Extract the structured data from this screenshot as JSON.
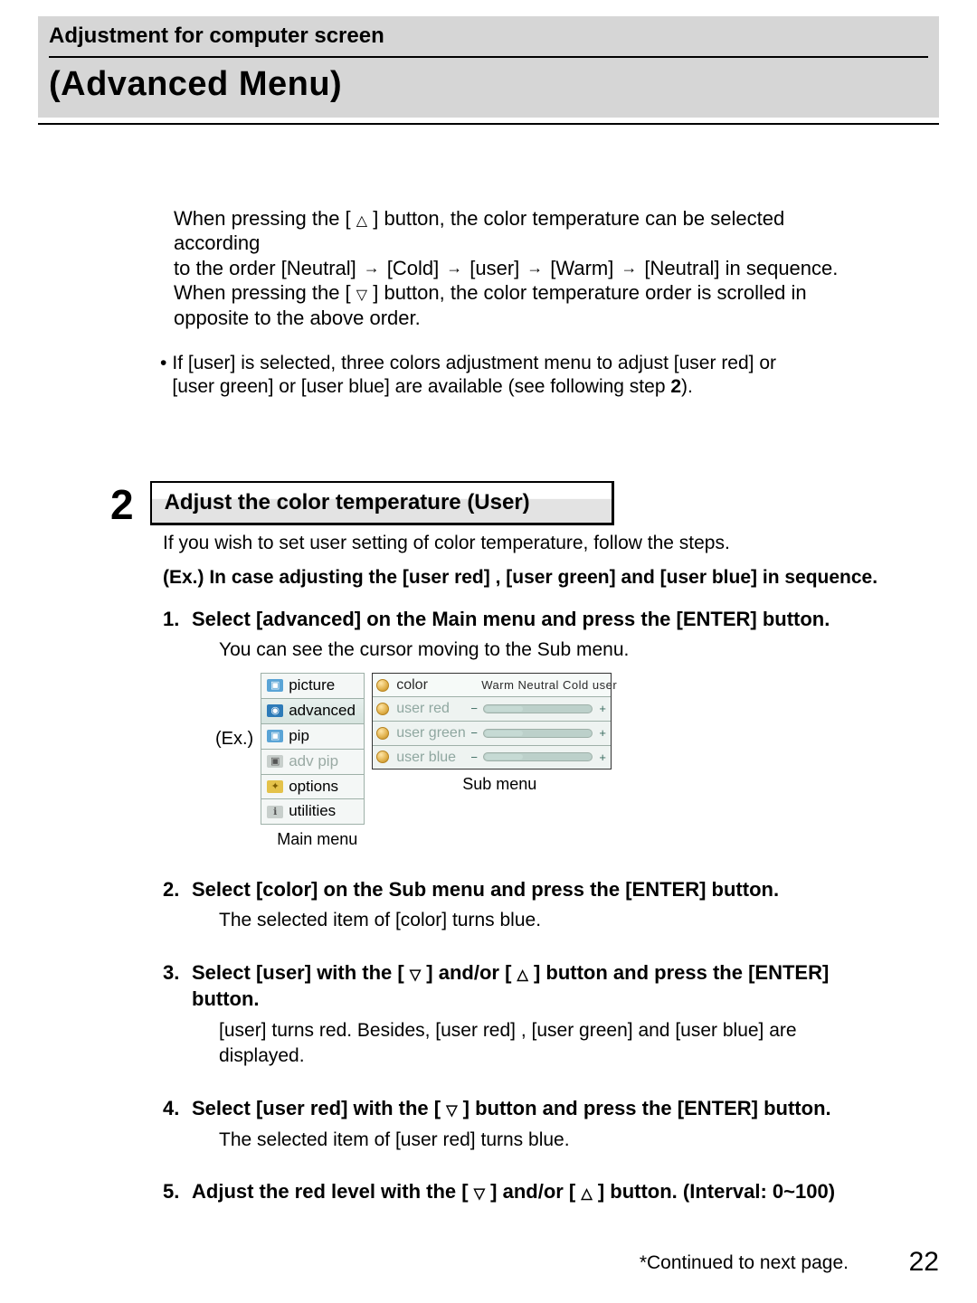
{
  "header": {
    "section_title": "Adjustment for computer screen",
    "page_title": "(Advanced Menu)"
  },
  "intro": {
    "line1_a": "When pressing the [",
    "line1_b": "] button, the color temperature can be selected according",
    "line2_a": "to the order [Neutral]",
    "line2_b": "[Cold]",
    "line2_c": "[user]",
    "line2_d": "[Warm]",
    "line2_e": "[Neutral] in sequence.",
    "line3_a": "When pressing the [",
    "line3_b": "] button, the color temperature order is scrolled in",
    "line4": "opposite to the above order."
  },
  "bullet": {
    "a": "If [user] is selected, three colors adjustment menu to adjust [user red] or",
    "b_1": "[user green] or [user blue] are available (see following step ",
    "b_num": "2",
    "b_2": ")."
  },
  "step2": {
    "num": "2",
    "head": "Adjust the color temperature (User)",
    "intro": "If you wish to set user setting of color temperature, follow the steps.",
    "ex_a": "(Ex.) In case adjusting the ",
    "ex_b": "[user red]",
    "ex_c": ", ",
    "ex_d": "[user green]",
    "ex_e": " and ",
    "ex_f": "[user blue]",
    "ex_g": " in sequence."
  },
  "list": {
    "i1": {
      "n": "1.",
      "head_a": "Select ",
      "head_b": "[advanced]",
      "head_c": " on the Main menu and press the [ENTER] button.",
      "body": "You can see the cursor moving to the Sub menu."
    },
    "i2": {
      "n": "2.",
      "head_a": "Select ",
      "head_b": "[color]",
      "head_c": " on the Sub menu and press the [ENTER] button.",
      "body_a": "The selected item of ",
      "body_b": "[color]",
      "body_c": " turns blue."
    },
    "i3": {
      "n": "3.",
      "head_a": "Select ",
      "head_b": "[user]",
      "head_c": " with the [",
      "head_d": "] and/or [",
      "head_e": "] button and press the [ENTER] button.",
      "body_a": "[user]",
      "body_b": " turns red. Besides, ",
      "body_c": "[user red]",
      "body_d": ", ",
      "body_e": "[user green]",
      "body_f": " and ",
      "body_g": "[user blue]",
      "body_h": " are displayed."
    },
    "i4": {
      "n": "4.",
      "head_a": "Select ",
      "head_b": "[user red]",
      "head_c": " with the [",
      "head_d": "] button and press the [ENTER] button.",
      "body_a": "The selected item of ",
      "body_b": "[user red]",
      "body_c": " turns blue."
    },
    "i5": {
      "n": "5.",
      "head_a": "Adjust the red level with the [",
      "head_b": "] and/or [",
      "head_c": "] button. ",
      "head_d": "(Interval: 0~100)"
    }
  },
  "illus": {
    "ex_label": "(Ex.)",
    "main_caption": "Main menu",
    "main_items": {
      "picture": "picture",
      "advanced": "advanced",
      "pip": "pip",
      "adv_pip": "adv pip",
      "options": "options",
      "utilities": "utilities"
    },
    "sub_caption": "Sub menu",
    "sub": {
      "color_label": "color",
      "opts": "Warm  Neutral  Cold  user",
      "user_red": "user  red",
      "user_green": "user  green",
      "user_blue": "user  blue",
      "minus": "−",
      "plus": "+"
    }
  },
  "footer": {
    "continued": "*Continued to next page.",
    "page_number": "22"
  }
}
